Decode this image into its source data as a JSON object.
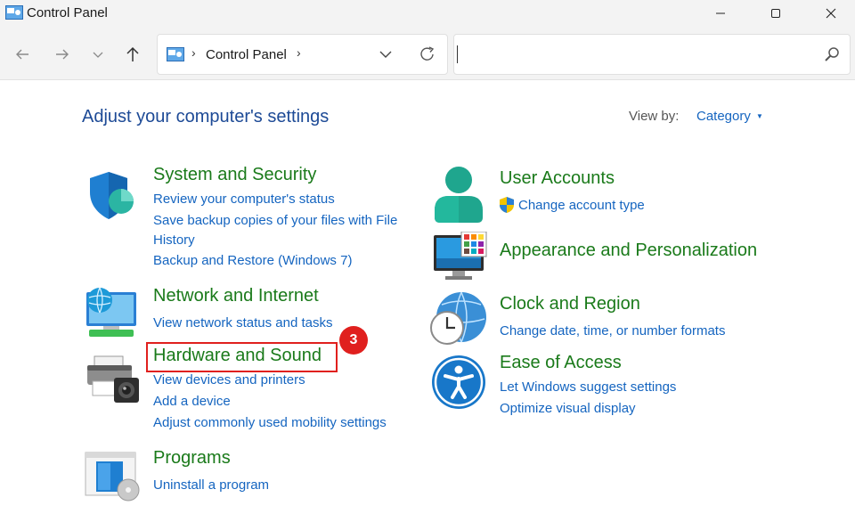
{
  "window": {
    "title": "Control Panel"
  },
  "address": {
    "path": "Control Panel",
    "sep": "›"
  },
  "search": {
    "placeholder": ""
  },
  "page": {
    "title": "Adjust your computer's settings"
  },
  "view_by": {
    "label": "View by:",
    "value": "Category"
  },
  "categories": {
    "system_security": {
      "title": "System and Security",
      "links": [
        "Review your computer's status",
        "Save backup copies of your files with File",
        "History",
        "Backup and Restore (Windows 7)"
      ]
    },
    "network": {
      "title": "Network and Internet",
      "links": [
        "View network status and tasks"
      ]
    },
    "hardware": {
      "title": "Hardware and Sound",
      "links": [
        "View devices and printers",
        "Add a device",
        "Adjust commonly used mobility settings"
      ]
    },
    "programs": {
      "title": "Programs",
      "links": [
        "Uninstall a program"
      ]
    },
    "user_accounts": {
      "title": "User Accounts",
      "links": [
        "Change account type"
      ]
    },
    "appearance": {
      "title": "Appearance and Personalization",
      "links": []
    },
    "clock": {
      "title": "Clock and Region",
      "links": [
        "Change date, time, or number formats"
      ]
    },
    "ease": {
      "title": "Ease of Access",
      "links": [
        "Let Windows suggest settings",
        "Optimize visual display"
      ]
    }
  },
  "annotation": {
    "step": "3"
  },
  "colors": {
    "heading": "#1d4a96",
    "category": "#1a7a1a",
    "link": "#1565c0",
    "highlight": "#e0201e"
  }
}
